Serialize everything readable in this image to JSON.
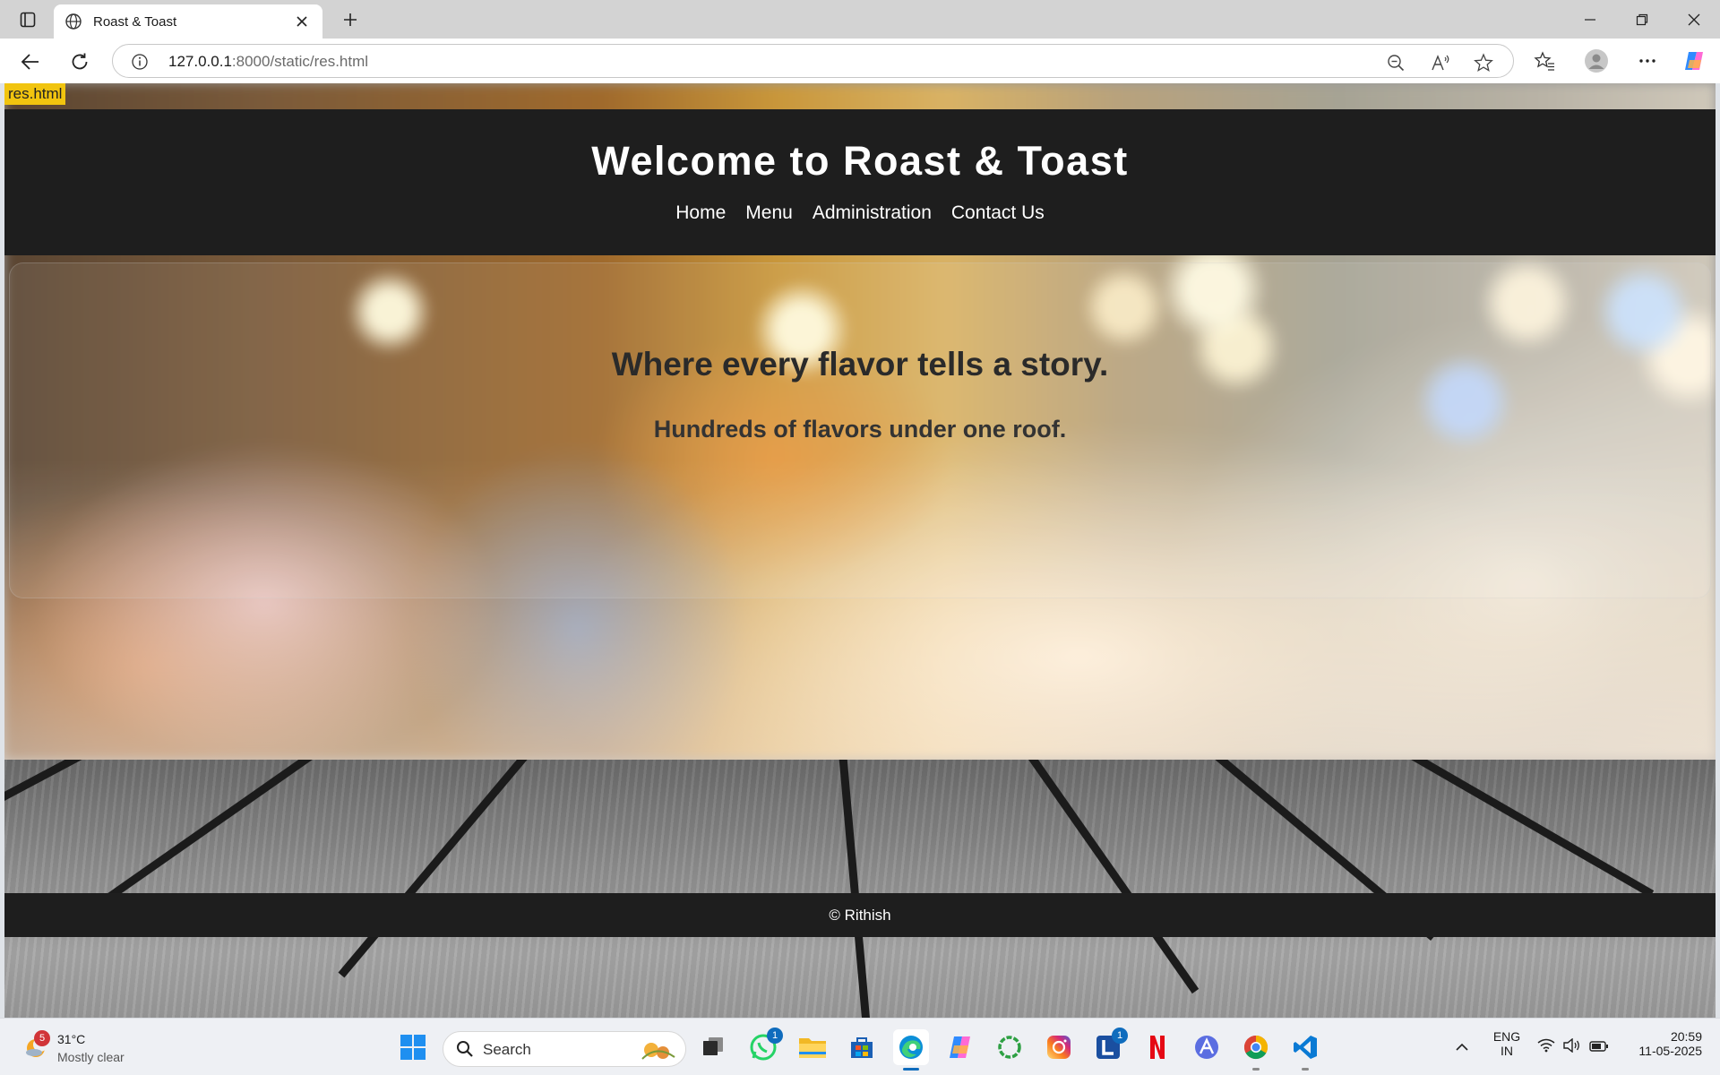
{
  "browser": {
    "tab_title": "Roast & Toast",
    "url_host": "127.0.0.1",
    "url_rest": ":8000/static/res.html"
  },
  "page": {
    "status_chip": "res.html",
    "site_title": "Welcome to Roast & Toast",
    "nav": [
      "Home",
      "Menu",
      "Administration",
      "Contact Us"
    ],
    "hero_title": "Where every flavor tells a story.",
    "hero_subtitle": "Hundreds of flavors under one roof.",
    "footer": "© Rithish"
  },
  "taskbar": {
    "weather_temp": "31°C",
    "weather_condition": "Mostly clear",
    "weather_badge": "5",
    "search_label": "Search",
    "whatsapp_badge": "1",
    "l_app_badge": "1",
    "language": "ENG",
    "region": "IN",
    "time": "20:59",
    "date": "11-05-2025"
  },
  "colors": {
    "header_bg": "#1e1e1e",
    "status_chip": "#f1c40f",
    "accent": "#0f6cbd"
  }
}
